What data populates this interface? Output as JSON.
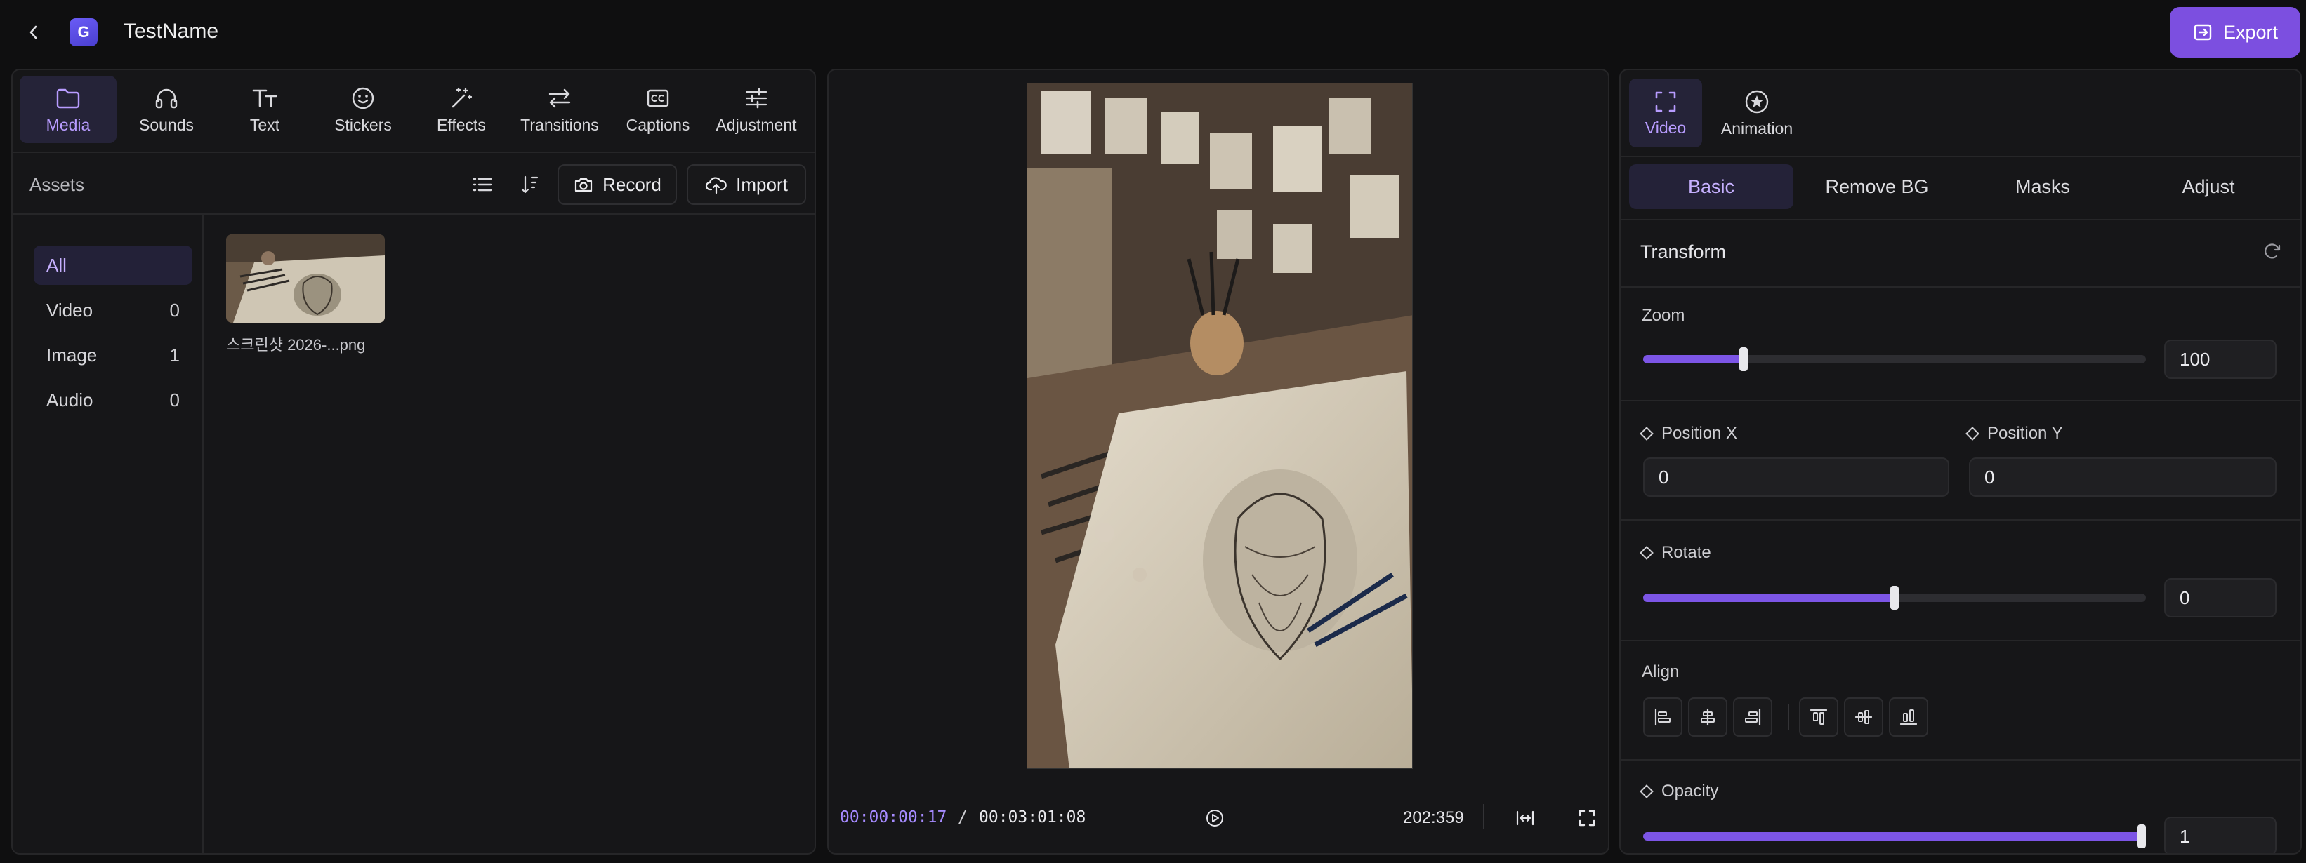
{
  "header": {
    "project_name": "TestName",
    "logo_letter": "G",
    "export_label": "Export"
  },
  "tools": [
    {
      "label": "Media",
      "icon": "folder-icon",
      "active": true
    },
    {
      "label": "Sounds",
      "icon": "headphones-icon"
    },
    {
      "label": "Text",
      "icon": "text-icon"
    },
    {
      "label": "Stickers",
      "icon": "smiley-icon"
    },
    {
      "label": "Effects",
      "icon": "magic-wand-icon"
    },
    {
      "label": "Transitions",
      "icon": "arrows-left-right-icon"
    },
    {
      "label": "Captions",
      "icon": "closed-caption-icon"
    },
    {
      "label": "Adjustment",
      "icon": "sliders-icon"
    }
  ],
  "assets": {
    "title": "Assets",
    "record_label": "Record",
    "import_label": "Import",
    "categories": [
      {
        "label": "All",
        "count": "",
        "active": true
      },
      {
        "label": "Video",
        "count": "0"
      },
      {
        "label": "Image",
        "count": "1"
      },
      {
        "label": "Audio",
        "count": "0"
      }
    ],
    "items": [
      {
        "name": "스크린샷 2026-...png"
      }
    ]
  },
  "preview": {
    "current_time": "00:00:00:17",
    "separator": "/",
    "total_time": "00:03:01:08",
    "ratio": "202:359"
  },
  "inspector": {
    "tabs": [
      {
        "label": "Video",
        "icon": "fullscreen-frame-icon",
        "active": true
      },
      {
        "label": "Animation",
        "icon": "star-circle-icon"
      }
    ],
    "subtabs": [
      {
        "label": "Basic",
        "active": true
      },
      {
        "label": "Remove BG"
      },
      {
        "label": "Masks"
      },
      {
        "label": "Adjust"
      }
    ],
    "transform": {
      "title": "Transform",
      "zoom_label": "Zoom",
      "zoom_value": "100",
      "zoom_fraction": 0.2,
      "position_x_label": "Position X",
      "position_x_value": "0",
      "position_y_label": "Position Y",
      "position_y_value": "0",
      "rotate_label": "Rotate",
      "rotate_value": "0",
      "rotate_fraction": 0.5,
      "align_label": "Align",
      "opacity_label": "Opacity",
      "opacity_value": "1",
      "opacity_fraction": 1.0
    }
  },
  "colors": {
    "accent": "#7c55e6",
    "export": "#7c4fe0",
    "timecode_current": "#a68bff"
  }
}
